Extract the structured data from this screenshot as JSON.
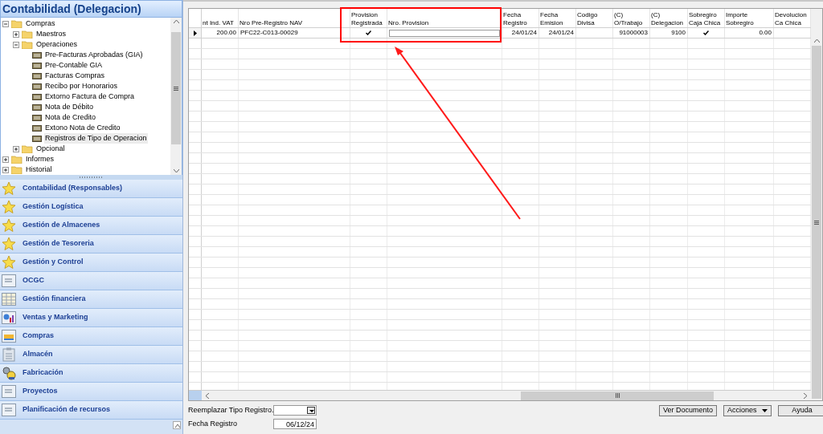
{
  "panel": {
    "title": "Contabilidad (Delegacion)"
  },
  "tree": [
    {
      "label": "Compras",
      "kind": "folder",
      "expanded": true,
      "children": [
        {
          "label": "Maestros",
          "kind": "folder",
          "expanded": false
        },
        {
          "label": "Operaciones",
          "kind": "folder",
          "expanded": true,
          "children": [
            {
              "label": "Pre-Facturas Aprobadas (GIA)",
              "kind": "form",
              "selected": false
            },
            {
              "label": "Pre-Contable GIA",
              "kind": "form",
              "selected": false
            },
            {
              "label": "Facturas Compras",
              "kind": "form",
              "selected": false
            },
            {
              "label": "Recibo por Honorarios",
              "kind": "form",
              "selected": false
            },
            {
              "label": "Extorno Factura de Compra",
              "kind": "form",
              "selected": false
            },
            {
              "label": "Nota de Débito",
              "kind": "form",
              "selected": false
            },
            {
              "label": "Nota de Credito",
              "kind": "form",
              "selected": false
            },
            {
              "label": "Extono Nota de Credito",
              "kind": "form",
              "selected": false
            },
            {
              "label": "Registros de Tipo de Operacion",
              "kind": "form",
              "selected": true
            }
          ]
        },
        {
          "label": "Opcional",
          "kind": "folder",
          "expanded": false
        }
      ]
    },
    {
      "label": "Informes",
      "kind": "folder",
      "expanded": false
    },
    {
      "label": "Historial",
      "kind": "folder",
      "expanded": false
    }
  ],
  "modules": [
    {
      "label": "Contabilidad (Responsables)",
      "kind": "star"
    },
    {
      "label": "Gestión Logística",
      "kind": "star"
    },
    {
      "label": "Gestión de Almacenes",
      "kind": "star"
    },
    {
      "label": "Gestión de Tesoreria",
      "kind": "star"
    },
    {
      "label": "Gestión y Control",
      "kind": "star"
    },
    {
      "label": "OCGC",
      "kind": "form"
    },
    {
      "label": "Gestión financiera",
      "kind": "grid"
    },
    {
      "label": "Ventas y Marketing",
      "kind": "chart"
    },
    {
      "label": "Compras",
      "kind": "tray"
    },
    {
      "label": "Almacén",
      "kind": "clipboard"
    },
    {
      "label": "Fabricación",
      "kind": "gears"
    },
    {
      "label": "Proyectos",
      "kind": "form"
    },
    {
      "label": "Planificación de recursos",
      "kind": "form"
    }
  ],
  "table": {
    "columns": [
      {
        "label": "nt Ind. VAT",
        "kind": "number"
      },
      {
        "label": "Nro Pre-Registro NAV",
        "kind": "text"
      },
      {
        "label": "Provision Registrada",
        "kind": "check"
      },
      {
        "label": "Nro. Provision",
        "kind": "input"
      },
      {
        "label": "Fecha Registro",
        "kind": "number"
      },
      {
        "label": "Fecha Emision",
        "kind": "number"
      },
      {
        "label": "Codigo Divisa",
        "kind": "text"
      },
      {
        "label": "(C) O/Trabajo",
        "kind": "number"
      },
      {
        "label": "(C) Delegacion",
        "kind": "number"
      },
      {
        "label": "Sobregiro Caja Chica",
        "kind": "check"
      },
      {
        "label": "Importe Sobregiro",
        "kind": "number"
      },
      {
        "label": "Devolucion Ca Chica",
        "kind": "text"
      }
    ],
    "rows": [
      {
        "current": true,
        "cells": [
          {
            "text": "200.00"
          },
          {
            "text": "PFC22-C013-00029"
          },
          {
            "checked": true
          },
          {},
          {
            "text": "24/01/24"
          },
          {
            "text": "24/01/24"
          },
          {},
          {
            "text": "91000003"
          },
          {
            "text": "9100"
          },
          {
            "checked": true
          },
          {
            "text": "0.00"
          },
          {}
        ]
      }
    ]
  },
  "footer": {
    "replace_label": "Reemplazar Tipo Registro.",
    "date_label": "Fecha Registro",
    "date_value": "06/12/24",
    "buttons": [
      {
        "label": "Ver Documento",
        "kind": "plain"
      },
      {
        "label": "Acciones",
        "kind": "menu"
      },
      {
        "label": "Ayuda",
        "kind": "plain"
      }
    ]
  }
}
